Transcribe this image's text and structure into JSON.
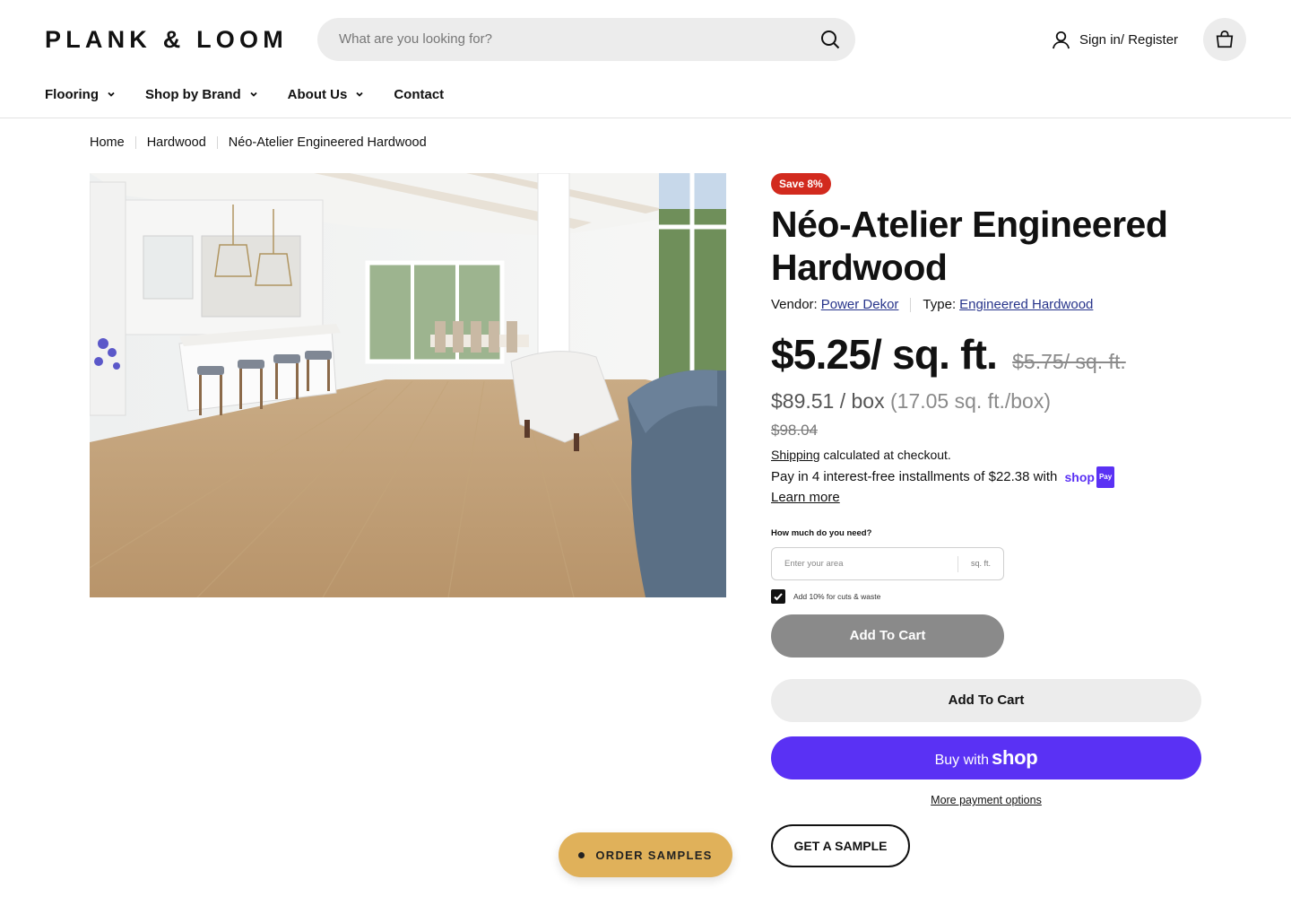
{
  "header": {
    "logo": "PLANK & LOOM",
    "search_placeholder": "What are you looking for?",
    "signin_label": "Sign in/ Register"
  },
  "nav": {
    "items": [
      {
        "label": "Flooring",
        "has_dropdown": true
      },
      {
        "label": "Shop by Brand",
        "has_dropdown": true
      },
      {
        "label": "About Us",
        "has_dropdown": true
      },
      {
        "label": "Contact",
        "has_dropdown": false
      }
    ]
  },
  "breadcrumb": [
    "Home",
    "Hardwood",
    "Néo-Atelier Engineered Hardwood"
  ],
  "product": {
    "badge": "Save 8%",
    "title": "Néo-Atelier Engineered Hardwood",
    "vendor_label": "Vendor:",
    "vendor": "Power Dekor",
    "type_label": "Type:",
    "type": "Engineered Hardwood",
    "price": "$5.25/ sq. ft.",
    "compare_price": "$5.75/ sq. ft.",
    "box_price": "$89.51 / box",
    "box_coverage": "(17.05 sq. ft./box)",
    "box_compare": "$98.04",
    "shipping_link": "Shipping",
    "shipping_rest": " calculated at checkout.",
    "installments_text": "Pay in 4 interest-free installments of $22.38 with",
    "shop_word": "shop",
    "pay_word": "Pay",
    "learn_more": "Learn more"
  },
  "calculator": {
    "label": "How much do you need?",
    "placeholder": "Enter your area",
    "unit": "sq. ft.",
    "waste_label": "Add 10% for cuts & waste",
    "waste_checked": true
  },
  "buttons": {
    "add_to_cart_primary": "Add To Cart",
    "add_to_cart_secondary": "Add To Cart",
    "buy_with": "Buy with",
    "buy_with_brand": "shop",
    "more_payment": "More payment options",
    "get_sample": "GET A SAMPLE",
    "order_samples": "ORDER SAMPLES"
  },
  "colors": {
    "badge": "#d22a1e",
    "shop_pay": "#5a31f4",
    "link": "#27348b",
    "order_samples": "#e0b15a"
  }
}
